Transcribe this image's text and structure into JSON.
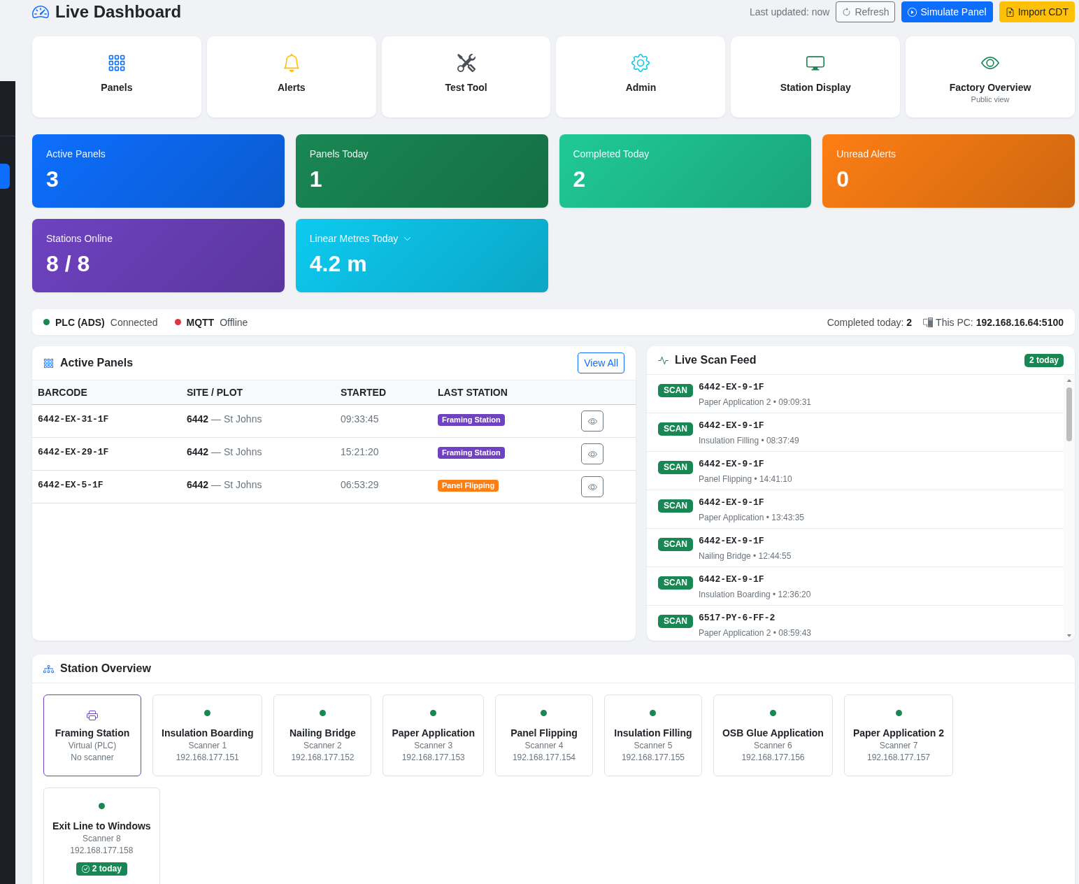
{
  "sidebar": {
    "items": [
      {
        "selected": true
      }
    ]
  },
  "header": {
    "title": "Live Dashboard",
    "last_updated": "Last updated: now",
    "buttons": [
      {
        "label": "Refresh",
        "kind": "outline"
      },
      {
        "label": "Simulate Panel",
        "kind": "primary"
      },
      {
        "label": "Import CDT",
        "kind": "warning"
      }
    ]
  },
  "nav_cards": [
    {
      "label": "Panels",
      "color": "#0d6efd"
    },
    {
      "label": "Alerts",
      "color": "#ffc107"
    },
    {
      "label": "Test Tool",
      "color": "#495057"
    },
    {
      "label": "Admin",
      "color": "#0dcaf0"
    },
    {
      "label": "Station Display",
      "color": "#198754"
    },
    {
      "label": "Factory Overview",
      "subtitle": "Public view",
      "color": "#198754"
    }
  ],
  "stats": [
    {
      "label": "Active Panels",
      "value": "3",
      "color": "#0d6efd",
      "menu": false
    },
    {
      "label": "Panels Today",
      "value": "1",
      "color": "#198754",
      "menu": false
    },
    {
      "label": "Completed Today",
      "value": "2",
      "color": "#20c997",
      "menu": false
    },
    {
      "label": "Unread Alerts",
      "value": "0",
      "color": "#fd7e14",
      "menu": false
    },
    {
      "label": "Stations Online",
      "value": "8 / 8",
      "color": "#6f42c1",
      "menu": false
    },
    {
      "label": "Linear Metres Today",
      "value": "4.2 m",
      "color": "#0dcaf0",
      "menu": true
    }
  ],
  "status_bar": {
    "services": [
      {
        "name": "PLC (ADS)",
        "state": "Connected",
        "connected": true
      },
      {
        "name": "MQTT",
        "state": "Offline",
        "connected": false
      }
    ],
    "completed": "Completed today: **2**",
    "host": "This PC: **192.168.16.64:5100**"
  },
  "active_panels": {
    "title": "Active Panels",
    "button": "View All",
    "columns": [
      "BARCODE",
      "SITE / PLOT",
      "STARTED",
      "LAST STATION"
    ],
    "rows": [
      {
        "barcode": "6442-EX-31-1F",
        "site_plot": "**6442** — St Johns",
        "started": "09:33:45",
        "last_station": "Framing Station",
        "color": "#6f42c1"
      },
      {
        "barcode": "6442-EX-29-1F",
        "site_plot": "**6442** — St Johns",
        "started": "15:21:20",
        "last_station": "Framing Station",
        "color": "#6f42c1"
      },
      {
        "barcode": "6442-EX-5-1F",
        "site_plot": "**6442** — St Johns",
        "started": "06:53:29",
        "last_station": "Panel Flipping",
        "color": "#fd7e14"
      }
    ]
  },
  "scan_feed": {
    "title": "Live Scan Feed",
    "badge": "2 today",
    "items": [
      {
        "tag": "SCAN",
        "barcode": "6442-EX-9-1F",
        "detail": "Paper Application 2 • 09:09:31"
      },
      {
        "tag": "SCAN",
        "barcode": "6442-EX-9-1F",
        "detail": "Insulation Filling • 08:37:49"
      },
      {
        "tag": "SCAN",
        "barcode": "6442-EX-9-1F",
        "detail": "Panel Flipping • 14:41:10"
      },
      {
        "tag": "SCAN",
        "barcode": "6442-EX-9-1F",
        "detail": "Paper Application • 13:43:35"
      },
      {
        "tag": "SCAN",
        "barcode": "6442-EX-9-1F",
        "detail": "Nailing Bridge • 12:44:55"
      },
      {
        "tag": "SCAN",
        "barcode": "6442-EX-9-1F",
        "detail": "Insulation Boarding • 12:36:20"
      },
      {
        "tag": "SCAN",
        "barcode": "6517-PY-6-FF-2",
        "detail": "Paper Application 2 • 08:59:43"
      }
    ]
  },
  "station_overview": {
    "title": "Station Overview",
    "stations": [
      {
        "kind": "virtual",
        "name": "Framing Station",
        "lines": [
          "Virtual (PLC)",
          "No scanner"
        ]
      },
      {
        "kind": "scanner",
        "name": "Insulation Boarding",
        "online": true,
        "lines": [
          "Scanner 1",
          "192.168.177.151"
        ]
      },
      {
        "kind": "scanner",
        "name": "Nailing Bridge",
        "online": true,
        "lines": [
          "Scanner 2",
          "192.168.177.152"
        ]
      },
      {
        "kind": "scanner",
        "name": "Paper Application",
        "online": true,
        "lines": [
          "Scanner 3",
          "192.168.177.153"
        ]
      },
      {
        "kind": "scanner",
        "name": "Panel Flipping",
        "online": true,
        "lines": [
          "Scanner 4",
          "192.168.177.154"
        ]
      },
      {
        "kind": "scanner",
        "name": "Insulation Filling",
        "online": true,
        "lines": [
          "Scanner 5",
          "192.168.177.155"
        ]
      },
      {
        "kind": "scanner",
        "name": "OSB Glue Application",
        "online": true,
        "lines": [
          "Scanner 6",
          "192.168.177.156"
        ]
      },
      {
        "kind": "scanner",
        "name": "Paper Application 2",
        "online": true,
        "lines": [
          "Scanner 7",
          "192.168.177.157"
        ]
      },
      {
        "kind": "scanner",
        "name": "Exit Line to Windows",
        "online": true,
        "lines": [
          "Scanner 8",
          "192.168.177.158"
        ],
        "badge": "2 today"
      }
    ]
  }
}
